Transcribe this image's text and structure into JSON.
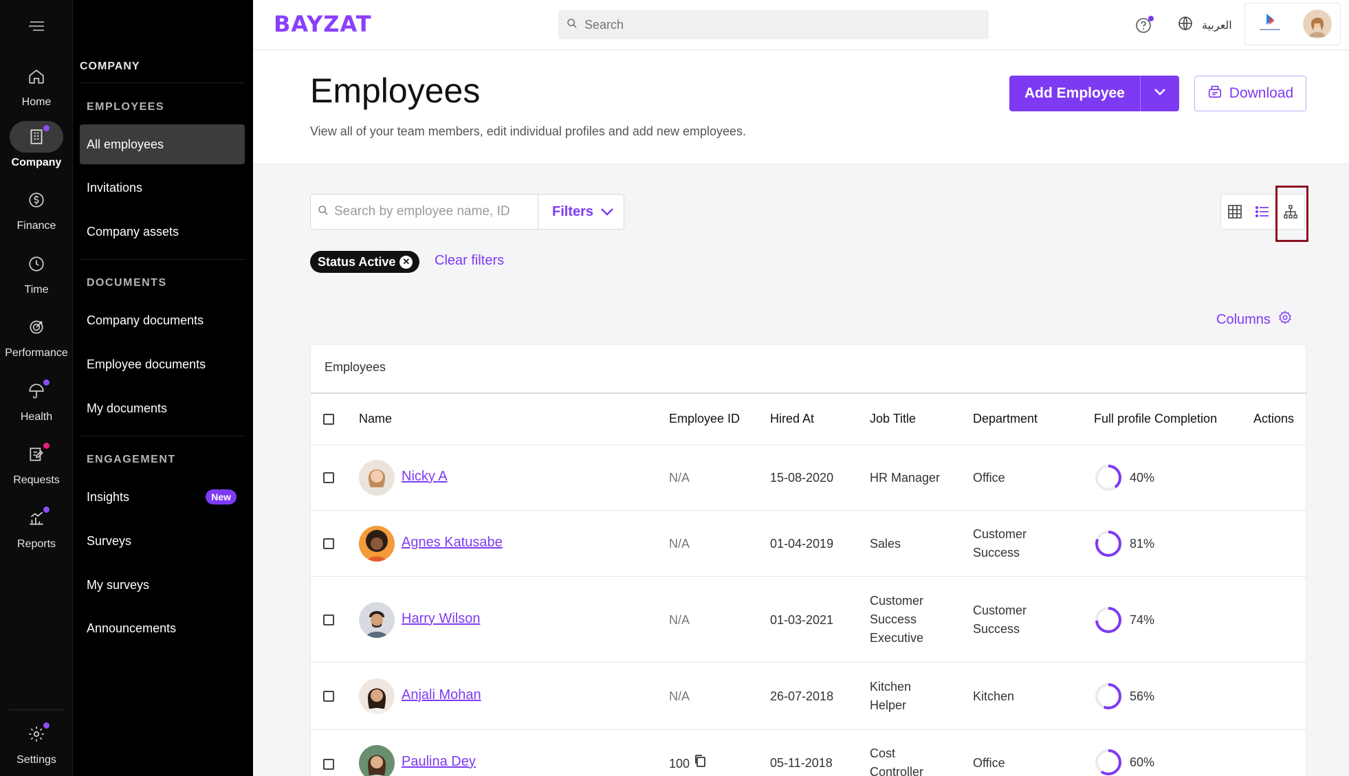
{
  "rail": {
    "items": [
      {
        "label": "Home",
        "icon": "home-icon"
      },
      {
        "label": "Company",
        "icon": "building-icon",
        "active": true
      },
      {
        "label": "Finance",
        "icon": "dollar-icon"
      },
      {
        "label": "Time",
        "icon": "clock-icon"
      },
      {
        "label": "Performance",
        "icon": "target-icon"
      },
      {
        "label": "Health",
        "icon": "umbrella-icon"
      },
      {
        "label": "Requests",
        "icon": "edit-icon"
      },
      {
        "label": "Reports",
        "icon": "chart-icon"
      }
    ],
    "settings_label": "Settings"
  },
  "sidebar": {
    "company_label": "COMPANY",
    "employees_section": "EMPLOYEES",
    "employees_items": [
      "All employees",
      "Invitations",
      "Company assets"
    ],
    "documents_section": "DOCUMENTS",
    "documents_items": [
      "Company documents",
      "Employee documents",
      "My documents"
    ],
    "engagement_section": "ENGAGEMENT",
    "engagement_items": [
      "Insights",
      "Surveys",
      "My surveys",
      "Announcements"
    ],
    "new_badge": "New"
  },
  "topbar": {
    "logo": "BAYZAT",
    "search_placeholder": "Search",
    "language": "العربية"
  },
  "header": {
    "title": "Employees",
    "subtitle": "View all of your team members, edit individual profiles and add new employees.",
    "add_employee": "Add Employee",
    "download": "Download"
  },
  "toolbar": {
    "search_placeholder": "Search by employee name, ID",
    "filters": "Filters",
    "chip_label": "Status Active",
    "clear_filters": "Clear filters",
    "columns": "Columns"
  },
  "table": {
    "caption": "Employees",
    "headers": {
      "name": "Name",
      "employee_id": "Employee ID",
      "hired_at": "Hired At",
      "job_title": "Job Title",
      "department": "Department",
      "completion": "Full profile Completion",
      "actions": "Actions"
    },
    "rows": [
      {
        "name": "Nicky A",
        "id": "N/A",
        "hired": "15-08-2020",
        "job": "HR Manager",
        "dept": "Office",
        "completion": "40%",
        "pct": 0.4
      },
      {
        "name": "Agnes Katusabe",
        "id": "N/A",
        "hired": "01-04-2019",
        "job": "Sales",
        "dept": "Customer Success",
        "completion": "81%",
        "pct": 0.81
      },
      {
        "name": "Harry Wilson",
        "id": "N/A",
        "hired": "01-03-2021",
        "job": "Customer Success Executive",
        "dept": "Customer Success",
        "completion": "74%",
        "pct": 0.74
      },
      {
        "name": "Anjali Mohan",
        "id": "N/A",
        "hired": "26-07-2018",
        "job": "Kitchen Helper",
        "dept": "Kitchen",
        "completion": "56%",
        "pct": 0.56
      },
      {
        "name": "Paulina Dey",
        "id": "100",
        "hired": "05-11-2018",
        "job": "Cost Controller",
        "dept": "Office",
        "completion": "60%",
        "pct": 0.6
      }
    ]
  },
  "colors": {
    "accent": "#7e3af2",
    "highlight": "#8b0f1e"
  }
}
